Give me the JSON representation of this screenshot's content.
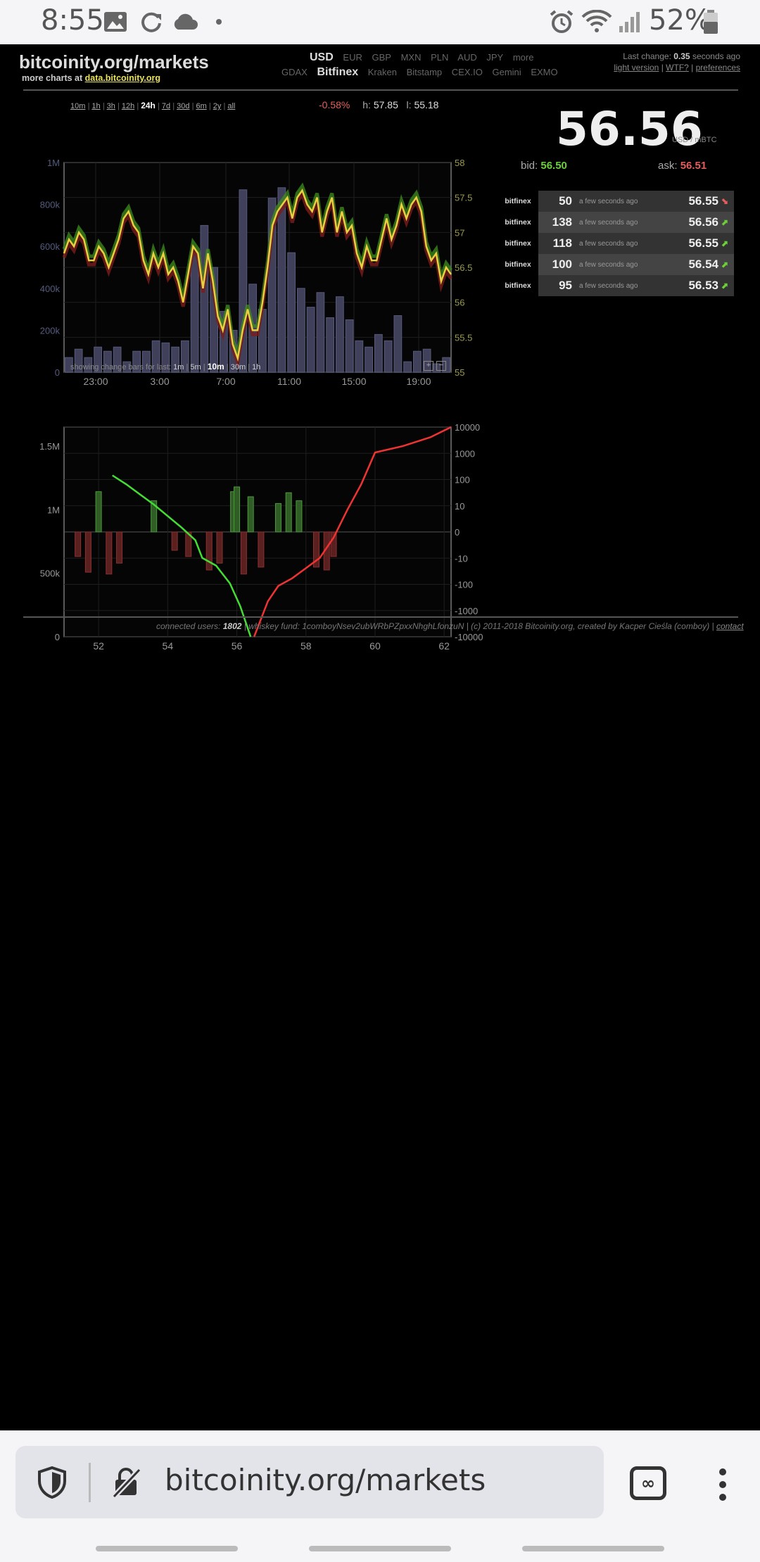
{
  "status": {
    "time": "8:55",
    "battery": "52%"
  },
  "header": {
    "logo": "bitcoinity.org/markets",
    "more_charts_prefix": "more charts at ",
    "more_charts_link": "data.bitcoinity.org",
    "currencies": [
      "USD",
      "EUR",
      "GBP",
      "MXN",
      "PLN",
      "AUD",
      "JPY",
      "more"
    ],
    "selected_currency": "USD",
    "exchanges": [
      "GDAX",
      "Bitfinex",
      "Kraken",
      "Bitstamp",
      "CEX.IO",
      "Gemini",
      "EXMO"
    ],
    "selected_exchange": "Bitfinex",
    "last_change_prefix": "Last change: ",
    "last_change_value": "0.35",
    "last_change_suffix": " seconds ago",
    "links": [
      "light version",
      "WTF?",
      "preferences"
    ]
  },
  "chart1": {
    "periods": [
      "10m",
      "1h",
      "3h",
      "12h",
      "24h",
      "7d",
      "30d",
      "6m",
      "2y",
      "all"
    ],
    "selected_period": "24h",
    "change": "-0.58%",
    "high_label": "h:",
    "high": "57.85",
    "low_label": "l:",
    "low": "55.18"
  },
  "price": {
    "value": "56.56",
    "unit": "USD / mBTC",
    "bid_label": "bid:",
    "bid": "56.50",
    "ask_label": "ask:",
    "ask": "56.51"
  },
  "trades": [
    {
      "exchange": "bitfinex",
      "amount": "50",
      "time": "a few seconds ago",
      "price": "56.55",
      "dir": "down"
    },
    {
      "exchange": "bitfinex",
      "amount": "138",
      "time": "a few seconds ago",
      "price": "56.56",
      "dir": "up"
    },
    {
      "exchange": "bitfinex",
      "amount": "118",
      "time": "a few seconds ago",
      "price": "56.55",
      "dir": "up"
    },
    {
      "exchange": "bitfinex",
      "amount": "100",
      "time": "a few seconds ago",
      "price": "56.54",
      "dir": "up"
    },
    {
      "exchange": "bitfinex",
      "amount": "95",
      "time": "a few seconds ago",
      "price": "56.53",
      "dir": "up"
    }
  ],
  "change_bars": {
    "label": "showing change bars for last:",
    "options": [
      "1m",
      "5m",
      "10m",
      "30m",
      "1h"
    ],
    "selected": "10m",
    "zoom_in": "+",
    "zoom_out": "−"
  },
  "footer": {
    "users_label": "connected users: ",
    "users": "1802",
    "rest": " | whiskey fund: 1comboyNsev2ubWRbPZpxxNhghLfonzuN | (c) 2011-2018 Bitcoinity.org, created by Kacper Cieśla (comboy) | ",
    "contact": "contact"
  },
  "browser": {
    "url": "bitcoinity.org/markets",
    "tabs_icon": "∞"
  },
  "colors": {
    "up": "#6ccf3a",
    "down": "#e35d5d",
    "price_line": "#e8d040",
    "volume_bar": "#40405a"
  },
  "chart_data": [
    {
      "type": "line",
      "title": "",
      "x_ticks": [
        "23:00",
        "3:00",
        "7:00",
        "11:00",
        "15:00",
        "19:00"
      ],
      "y_left_ticks": [
        "0",
        "200k",
        "400k",
        "600k",
        "800k",
        "1M"
      ],
      "y_right_ticks": [
        "55",
        "55.5",
        "56",
        "56.5",
        "57",
        "57.5",
        "58"
      ],
      "ylim": [
        55,
        58
      ],
      "volume_ylim": [
        0,
        1000000
      ],
      "grid": true,
      "series": [
        {
          "values": [
            56.7,
            56.9,
            56.8,
            57.0,
            56.9,
            56.6,
            56.6,
            56.8,
            56.7,
            56.5,
            56.7,
            56.9,
            57.2,
            57.3,
            57.1,
            57.0,
            56.6,
            56.4,
            56.7,
            56.5,
            56.7,
            56.4,
            56.5,
            56.3,
            56.0,
            56.4,
            56.8,
            56.7,
            56.2,
            56.7,
            56.3,
            55.8,
            55.6,
            55.9,
            55.4,
            55.2,
            55.6,
            55.9,
            55.6,
            55.6,
            56.0,
            56.5,
            57.1,
            57.3,
            57.4,
            57.5,
            57.2,
            57.5,
            57.6,
            57.4,
            57.3,
            57.5,
            57.0,
            57.3,
            57.5,
            57.0,
            57.3,
            57.0,
            57.1,
            56.7,
            56.5,
            56.8,
            56.6,
            56.6,
            56.9,
            57.2,
            56.9,
            57.1,
            57.4,
            57.2,
            57.4,
            57.5,
            57.3,
            56.8,
            56.6,
            56.7,
            56.3,
            56.5,
            56.4
          ]
        },
        {
          "type": "bar",
          "values": [
            70000,
            110000,
            70000,
            120000,
            100000,
            120000,
            50000,
            100000,
            100000,
            150000,
            140000,
            120000,
            150000,
            570000,
            700000,
            500000,
            290000,
            200000,
            870000,
            420000,
            300000,
            830000,
            880000,
            570000,
            400000,
            310000,
            380000,
            260000,
            360000,
            250000,
            150000,
            120000,
            180000,
            150000,
            270000,
            50000,
            100000,
            110000,
            40000,
            70000
          ]
        }
      ]
    },
    {
      "type": "line",
      "title": "",
      "x_ticks": [
        "52",
        "54",
        "56",
        "58",
        "60",
        "62"
      ],
      "xlim": [
        51,
        62.2
      ],
      "y_left_ticks": [
        "0",
        "500k",
        "1M",
        "1.5M"
      ],
      "y_right_ticks": [
        "-10000",
        "-1000",
        "-100",
        "-10",
        "0",
        "10",
        "100",
        "1000",
        "10000"
      ],
      "grid": true,
      "series": [
        {
          "name": "bids",
          "x": [
            52.4,
            52.8,
            53.2,
            53.6,
            54.0,
            54.4,
            54.8,
            55.0,
            55.4,
            55.8,
            56.1,
            56.4
          ],
          "y": [
            1270000,
            1200000,
            1120000,
            1040000,
            950000,
            860000,
            760000,
            620000,
            560000,
            420000,
            240000,
            0
          ]
        },
        {
          "name": "asks",
          "x": [
            56.5,
            56.9,
            57.2,
            57.6,
            58.0,
            58.4,
            58.8,
            59.2,
            59.6,
            60.0,
            60.8,
            61.6,
            62.2
          ],
          "y": [
            0,
            280000,
            400000,
            460000,
            540000,
            620000,
            780000,
            1000000,
            1200000,
            1450000,
            1500000,
            1570000,
            1650000
          ]
        },
        {
          "type": "change-bars",
          "x": [
            51.4,
            51.7,
            52.0,
            52.3,
            52.6,
            53.6,
            54.2,
            54.6,
            55.2,
            55.5,
            55.9,
            56.0,
            56.2,
            56.4,
            56.7,
            57.2,
            57.5,
            57.8,
            58.3,
            58.6,
            58.8
          ],
          "y": [
            -10,
            -50,
            50,
            -60,
            -20,
            20,
            -5,
            -10,
            -40,
            -20,
            50,
            80,
            -60,
            30,
            -30,
            15,
            45,
            20,
            -30,
            -40,
            -10
          ]
        }
      ]
    }
  ]
}
